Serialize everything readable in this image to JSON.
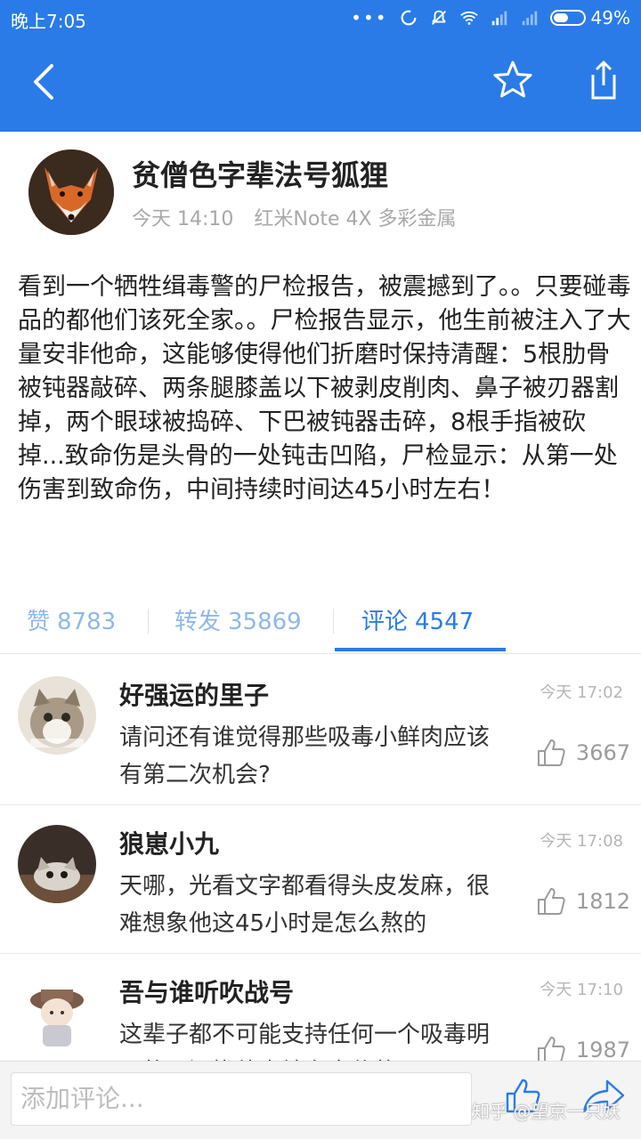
{
  "status_bar": {
    "time": "晚上7:05",
    "battery_percent": "49%",
    "battery_level": 0.49
  },
  "author": {
    "name": "贫僧色字辈法号狐狸",
    "time": "今天 14:10",
    "device": "红米Note 4X 多彩金属"
  },
  "post": {
    "body": "看到一个牺牲缉毒警的尸检报告，被震撼到了。。只要碰毒品的都他们该死全家。。尸检报告显示，他生前被注入了大量安非他命，这能够使得他们折磨时保持清醒：5根肋骨被钝器敲碎、两条腿膝盖以下被剥皮削肉、鼻子被刃器割掉，两个眼球被捣碎、下巴被钝器击碎，8根手指被砍掉...致命伤是头骨的一处钝击凹陷，尸检显示：从第一处伤害到致命伤，中间持续时间达45小时左右！"
  },
  "stats": {
    "likes_label": "赞",
    "likes": "8783",
    "reposts_label": "转发",
    "reposts": "35869",
    "comments_label": "评论",
    "comments": "4547",
    "active_tab": "comments"
  },
  "comments": [
    {
      "name": "好强运的里子",
      "time": "今天 17:02",
      "text": "请问还有谁觉得那些吸毒小鲜肉应该有第二次机会?",
      "likes": "3667"
    },
    {
      "name": "狼崽小九",
      "time": "今天 17:08",
      "text": "天哪，光看文字都看得头皮发麻，很难想象他这45小时是怎么熬的",
      "likes": "1812"
    },
    {
      "name": "吾与谁听吹战号",
      "time": "今天 17:10",
      "text": "这辈子都不可能支持任何一个吸毒明星的，还拢他表站台宣传的",
      "likes": "1987"
    }
  ],
  "bottom_bar": {
    "comment_placeholder": "添加评论...",
    "watermark": "知乎 @望京一只妖"
  },
  "icons": {
    "back": "back-arrow-icon",
    "favorite": "star-icon",
    "share": "share-icon",
    "like": "thumb-up-icon",
    "forward": "forward-arrow-icon"
  },
  "colors": {
    "brand_blue": "#2a7be7",
    "light_blue_text": "#8fb8e8",
    "meta_gray": "#a8a8a8"
  }
}
